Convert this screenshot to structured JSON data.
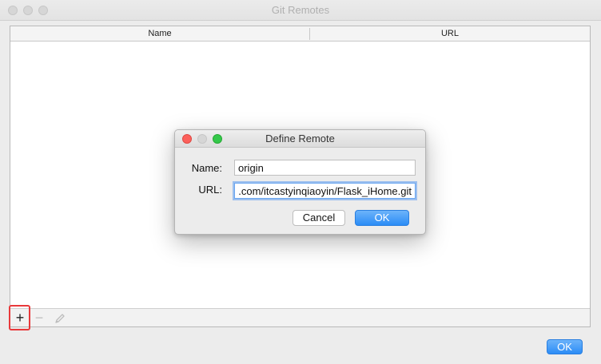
{
  "window": {
    "title": "Git Remotes",
    "ok_label": "OK"
  },
  "table": {
    "columns": [
      "Name",
      "URL"
    ],
    "rows": []
  },
  "toolbar": {
    "add_label": "+",
    "remove_label": "−"
  },
  "dialog": {
    "title": "Define Remote",
    "name_label": "Name:",
    "name_value": "origin",
    "url_label": "URL:",
    "url_value": "https://github.com/itcastyinqiaoyin/Flask_iHome.git",
    "cancel_label": "Cancel",
    "ok_label": "OK"
  },
  "colors": {
    "accent": "#2b8cf6",
    "highlight": "#e8393b",
    "close": "#fc605b",
    "minimize": "#fdbc40",
    "zoom": "#34c84a"
  }
}
